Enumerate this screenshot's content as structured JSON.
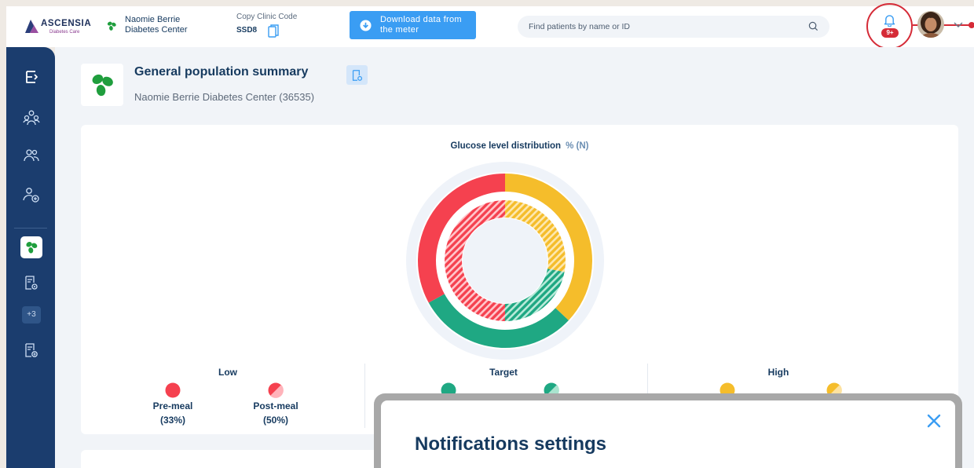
{
  "brand": {
    "name": "ASCENSIA",
    "subtitle": "Diabetes Care"
  },
  "clinic": {
    "name": "Naomie Berrie Diabetes Center"
  },
  "clinic_code": {
    "label": "Copy Clinic Code",
    "value": "SSD8"
  },
  "download_button": {
    "label": "Download data from the meter"
  },
  "search": {
    "placeholder": "Find patients by name or ID"
  },
  "notifications": {
    "badge": "9+"
  },
  "sidebar": {
    "items": [
      {
        "icon": "exit-icon"
      },
      {
        "icon": "organization-icon"
      },
      {
        "icon": "patients-icon"
      },
      {
        "icon": "add-patient-icon"
      },
      {
        "icon": "clinic-clover-icon",
        "active": true
      },
      {
        "icon": "report-settings-icon"
      },
      {
        "icon": "add-report-icon"
      }
    ],
    "more_label": "+3"
  },
  "summary": {
    "title": "General population summary",
    "subtitle": "Naomie Berrie Diabetes Center (36535)"
  },
  "chart": {
    "title": "Glucose level distribution",
    "unit": "% (N)"
  },
  "chart_data": {
    "type": "pie",
    "title": "Glucose level distribution",
    "unit": "% (N)",
    "series": [
      {
        "name": "Pre-meal",
        "slices": [
          {
            "category": "Low",
            "value": 33,
            "color": "#f5414f"
          },
          {
            "category": "Target",
            "value": 30,
            "color": "#1fa883"
          },
          {
            "category": "High",
            "value": 37,
            "color": "#f5bd2b"
          }
        ]
      },
      {
        "name": "Post-meal",
        "slices": [
          {
            "category": "Low",
            "value": 50,
            "color": "#f5414f"
          },
          {
            "category": "Target",
            "value": 22,
            "color": "#1fa883"
          },
          {
            "category": "High",
            "value": 28,
            "color": "#f5bd2b"
          }
        ]
      }
    ]
  },
  "legend": {
    "low": {
      "title": "Low",
      "items": [
        {
          "label": "Pre-meal",
          "value": "(33%)"
        },
        {
          "label": "Post-meal",
          "value": "(50%)"
        }
      ]
    },
    "target": {
      "title": "Target"
    },
    "high": {
      "title": "High"
    }
  },
  "colors": {
    "low": "#f5414f",
    "target": "#1fa883",
    "high": "#f5bd2b",
    "primary": "#163a5f",
    "sidebar": "#1b3d6e",
    "accent": "#3a9df3",
    "alert": "#d52b37"
  },
  "modal": {
    "title": "Notifications settings"
  }
}
